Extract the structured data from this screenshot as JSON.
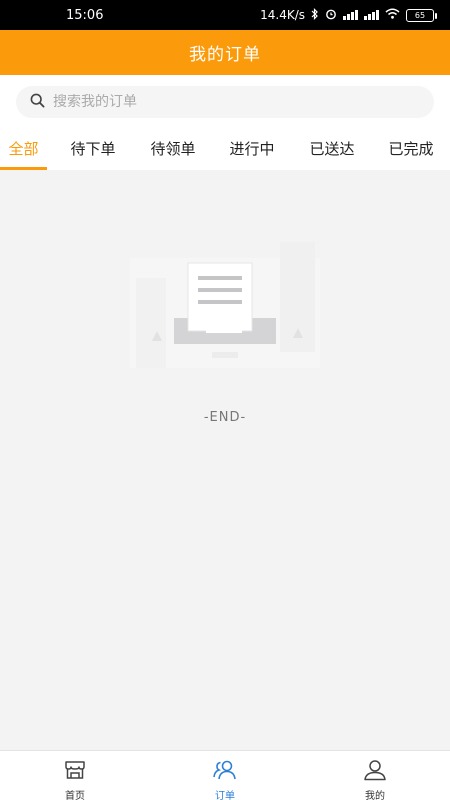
{
  "status_bar": {
    "time": "15:06",
    "speed": "14.4K/s",
    "battery": "65"
  },
  "header": {
    "title": "我的订单"
  },
  "search": {
    "placeholder": "搜索我的订单",
    "value": ""
  },
  "tabs": [
    {
      "label": "全部",
      "active": true
    },
    {
      "label": "待下单",
      "active": false
    },
    {
      "label": "待领单",
      "active": false
    },
    {
      "label": "进行中",
      "active": false
    },
    {
      "label": "已送达",
      "active": false
    },
    {
      "label": "已完成",
      "active": false
    }
  ],
  "content": {
    "end_text": "-END-"
  },
  "bottom_nav": {
    "items": [
      {
        "label": "首页",
        "icon": "shop-icon",
        "active": false
      },
      {
        "label": "订单",
        "icon": "users-icon",
        "active": true
      },
      {
        "label": "我的",
        "icon": "person-icon",
        "active": false
      }
    ]
  },
  "colors": {
    "accent": "#fb9a0a",
    "nav_active": "#2c7fd6",
    "background": "#f3f3f3"
  }
}
